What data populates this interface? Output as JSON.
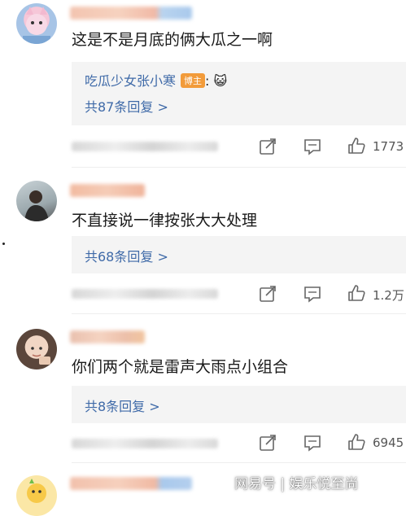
{
  "comments": [
    {
      "text": "这是不是月底的俩大瓜之一啊",
      "sub_reply": {
        "user": "吃瓜少女张小寒",
        "badge": "博主",
        "content": ": 😺"
      },
      "reply_count": "共87条回复 >",
      "likes": "1773"
    },
    {
      "text": "不直接说一律按张大大处理",
      "reply_count": "共68条回复 >",
      "likes": "1.2万"
    },
    {
      "text": "你们两个就是雷声大雨点小组合",
      "reply_count": "共8条回复 >",
      "likes": "6945"
    }
  ],
  "watermark": "网易号 | 娱乐悦至尚",
  "icons": [
    "share-icon",
    "comment-icon",
    "like-icon"
  ]
}
